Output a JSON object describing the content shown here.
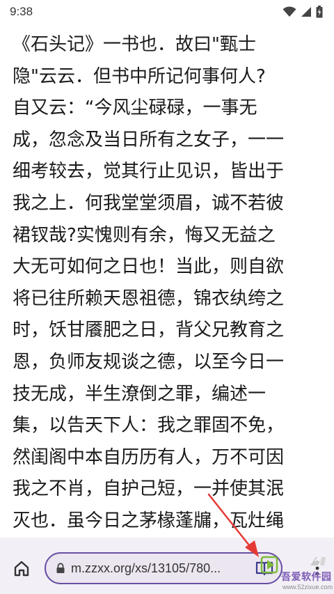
{
  "status_bar": {
    "time": "9:38",
    "icons": [
      "wifi-icon",
      "signal-icon",
      "battery-charging-icon"
    ]
  },
  "reader": {
    "lines": [
      "《石头记》一书也．故曰\"甄士",
      "隐\"云云．但书中所记何事何人?",
      "自又云：“今风尘碌碌，一事无",
      "成，忽念及当日所有之女子，一一",
      "细考较去，觉其行止见识，皆出于",
      "我之上．何我堂堂须眉，诚不若彼",
      "裙钗哉?实愧则有余，悔又无益之",
      "大无可如何之日也！当此，则自欲",
      "将已往所赖天恩祖德，锦衣纨绔之",
      "时，饫甘餍肥之日，背父兄教育之",
      "恩，负师友规谈之德，以至今日一",
      "技无成，半生潦倒之罪，编述一",
      "集，以告天下人：我之罪固不免，",
      "然闺阁中本自历历有人，万不可因",
      "我之不肖，自护己短，一并使其泯",
      "灭也．虽今日之茅椽蓬牖，瓦灶绳"
    ]
  },
  "toolbar": {
    "url": "m.zzxx.org/xs/13105/780...",
    "icons": {
      "home": "home-icon",
      "lock": "lock-icon",
      "reader_mode": "book-open-icon",
      "more": "more-vertical-icon"
    }
  },
  "annotation": {
    "arrow_color": "#e53935"
  },
  "watermark": {
    "title": "吾爱软件园",
    "url": "www.52zixue.com"
  },
  "colors": {
    "accent": "#6750a4",
    "toolbar_bg": "#f3eff7",
    "url_bg": "#ece6f0",
    "text": "#1a1a1a"
  }
}
